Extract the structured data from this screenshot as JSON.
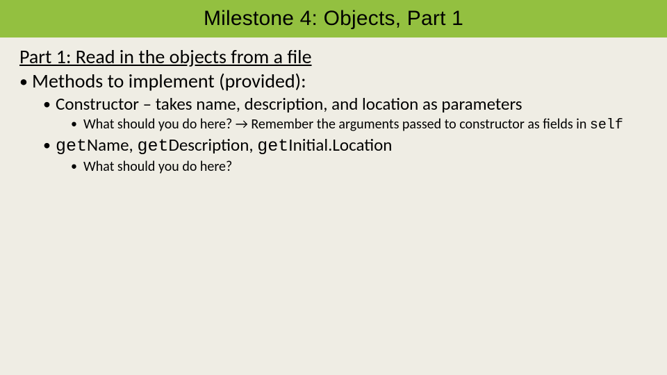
{
  "header": {
    "title": "Milestone 4: Objects, Part 1"
  },
  "subtitle": "Part 1: Read in the objects from a file",
  "bullets": {
    "methods_intro": "Methods to implement (provided):",
    "constructor": "Constructor – takes name, description, and location as parameters",
    "constructor_hint_pre": "What should you do here? → Remember the arguments passed to constructor as fields in ",
    "constructor_hint_code": "self",
    "getters_pre": "get",
    "getters_name": "Name",
    "getters_sep": ", ",
    "getters_desc": "Description",
    "getters_initloc": "Initial.Location",
    "getters_hint": "What should you do here?"
  }
}
